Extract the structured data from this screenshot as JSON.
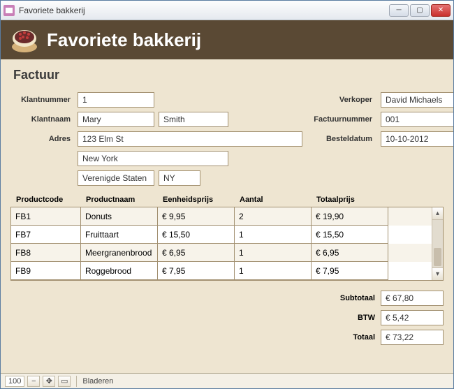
{
  "window": {
    "title": "Favoriete bakkerij"
  },
  "header": {
    "app_title": "Favoriete bakkerij"
  },
  "section": {
    "title": "Factuur"
  },
  "form": {
    "labels": {
      "klantnummer": "Klantnummer",
      "klantnaam": "Klantnaam",
      "adres": "Adres",
      "verkoper": "Verkoper",
      "factuurnummer": "Factuurnummer",
      "besteldatum": "Besteldatum"
    },
    "klantnummer": "1",
    "klant_voornaam": "Mary",
    "klant_achternaam": "Smith",
    "adres_straat": "123 Elm St",
    "adres_stad": "New York",
    "adres_land": "Verenigde Staten",
    "adres_staat": "NY",
    "verkoper": "David Michaels",
    "factuurnummer": "001",
    "besteldatum": "10-10-2012"
  },
  "table": {
    "headers": {
      "productcode": "Productcode",
      "productnaam": "Productnaam",
      "eenheidsprijs": "Eenheidsprijs",
      "aantal": "Aantal",
      "totaalprijs": "Totaalprijs"
    },
    "rows": [
      {
        "code": "FB1",
        "naam": "Donuts",
        "prijs": "€ 9,95",
        "aantal": "2",
        "totaal": "€ 19,90"
      },
      {
        "code": "FB7",
        "naam": "Fruittaart",
        "prijs": "€ 15,50",
        "aantal": "1",
        "totaal": "€ 15,50"
      },
      {
        "code": "FB8",
        "naam": "Meergranenbrood",
        "prijs": "€ 6,95",
        "aantal": "1",
        "totaal": "€ 6,95"
      },
      {
        "code": "FB9",
        "naam": "Roggebrood",
        "prijs": "€ 7,95",
        "aantal": "1",
        "totaal": "€ 7,95"
      }
    ]
  },
  "totals": {
    "labels": {
      "subtotaal": "Subtotaal",
      "btw": "BTW",
      "totaal": "Totaal"
    },
    "subtotaal": "€ 67,80",
    "btw": "€ 5,42",
    "totaal": "€ 73,22"
  },
  "statusbar": {
    "zoom": "100",
    "bladeren": "Bladeren"
  }
}
